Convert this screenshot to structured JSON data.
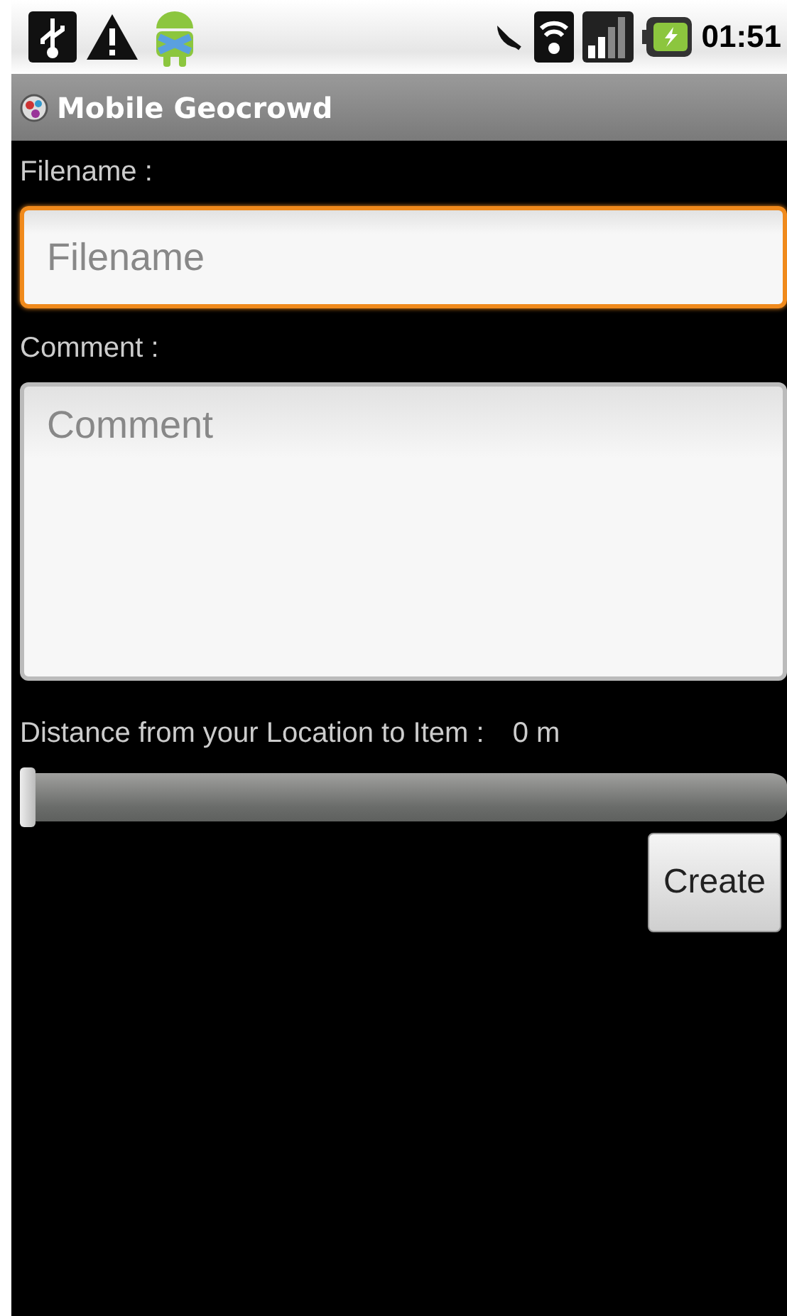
{
  "status_bar": {
    "time": "01:51"
  },
  "title_bar": {
    "title": "Mobile Geocrowd"
  },
  "form": {
    "fields": [
      {
        "label": "Filename :",
        "placeholder": "Filename",
        "focused": true,
        "kind": "single"
      },
      {
        "label": "Comment :",
        "placeholder": "Comment",
        "focused": false,
        "kind": "multi"
      }
    ],
    "distance": {
      "label": "Distance from your Location to Item :",
      "reading": "0 m",
      "level": 0
    },
    "button": "Create"
  }
}
